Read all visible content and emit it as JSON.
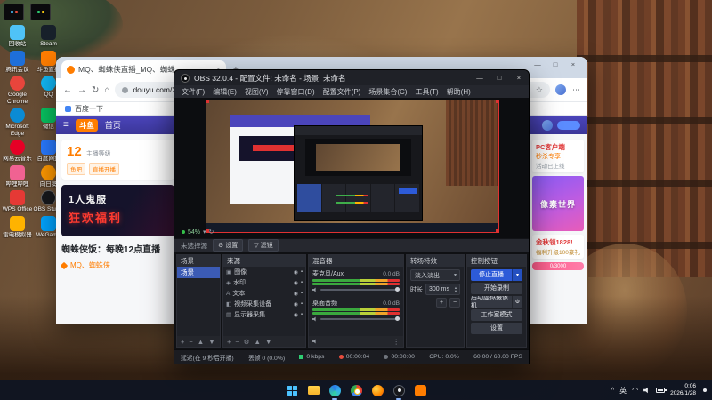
{
  "icons": {
    "close": "×",
    "minimize": "—",
    "maximize": "□",
    "back": "←",
    "forward": "→",
    "reload": "↻",
    "home": "⌂",
    "star": "☆",
    "dots": "⋯",
    "plus": "+",
    "minus": "−",
    "caret_down": "▾",
    "arrow_up": "▲",
    "arrow_down": "▼",
    "gear": "⚙",
    "eye": "◉",
    "lock": "▪",
    "kebab": "⋮",
    "menu": "≡",
    "funnel": "▽",
    "chevron_up": "^",
    "wifi": "◠"
  },
  "desktop": {
    "icons": [
      {
        "label": "回收站"
      },
      {
        "label": "腾讯会议"
      },
      {
        "label": "Google Chrome"
      },
      {
        "label": "Microsoft Edge"
      },
      {
        "label": "网易云音乐"
      },
      {
        "label": "哔哩哔哩"
      },
      {
        "label": "WPS Office"
      },
      {
        "label": "雷电模拟器"
      },
      {
        "label": "Steam"
      },
      {
        "label": "斗鱼直播"
      },
      {
        "label": "QQ"
      },
      {
        "label": "微信"
      },
      {
        "label": "百度网盘"
      },
      {
        "label": "向日葵"
      },
      {
        "label": "OBS Studio"
      },
      {
        "label": "WeGame"
      }
    ]
  },
  "taskbar": {
    "ime": "英",
    "time": "0:06",
    "date": "2026/1/28"
  },
  "browser": {
    "tab_title": "MQ、蜘蛛侠直播_MQ、蜘蛛…",
    "url": "douyu.com/2260377?dyshid=…",
    "bookmark": "百度一下",
    "douyu": {
      "logo": "斗鱼",
      "home": "首页",
      "level": "12",
      "level_label": "主播等级",
      "badge1": "鱼吧",
      "badge2": "直播开播",
      "banner_line1": "1人鬼服",
      "banner_line2": "狂欢福利",
      "room_title": "蜘蛛侠饭：每晚12点直播",
      "streamer": "MQ、蜘蛛侠",
      "rail": {
        "client": "PC客户端",
        "flash": "秒杀专享",
        "note": "活动已上线",
        "pixel": "像素世界",
        "promo1": "金秋领1828!",
        "promo2": "福利升级100豪礼",
        "progress": "0/3000"
      }
    }
  },
  "obs": {
    "title": "OBS 32.0.4 - 配置文件: 未命名 - 场景: 未命名",
    "menus": [
      "文件(F)",
      "编辑(E)",
      "视图(V)",
      "停靠窗口(D)",
      "配置文件(P)",
      "场景集合(C)",
      "工具(T)",
      "帮助(H)"
    ],
    "zoom": "54%",
    "srcbar": {
      "none": "未选择源",
      "settings": "设置",
      "filters": "滤镜"
    },
    "scenes": {
      "header": "场景",
      "item": "场景"
    },
    "sources": {
      "header": "来源",
      "items": [
        "图像",
        "水印",
        "文本",
        "视频采集设备",
        "显示器采集"
      ],
      "type_icons": [
        "▣",
        "◈",
        "A",
        "◧",
        "▤"
      ]
    },
    "mixer": {
      "header": "混音器",
      "ch1": {
        "name": "麦克风/Aux",
        "db": "0.0 dB"
      },
      "ch2": {
        "name": "桌面音频",
        "db": "0.0 dB"
      }
    },
    "transitions": {
      "header": "转场特效",
      "current": "淡入淡出",
      "duration_label": "时长",
      "duration": "300 ms"
    },
    "controls": {
      "header": "控制按钮",
      "stop": "停止直播",
      "record": "开始录制",
      "vcam": "启动虚拟摄像机",
      "studio": "工作室模式",
      "settings": "设置"
    },
    "status": {
      "delay": "延迟(在 9 秒后开播)",
      "dropped": "丢帧 0 (0.0%)",
      "bitrate": "0 kbps",
      "live": "00:00:04",
      "rec": "00:00:00",
      "cpu": "CPU: 0.0%",
      "fps": "60.00 / 60.00 FPS"
    }
  }
}
